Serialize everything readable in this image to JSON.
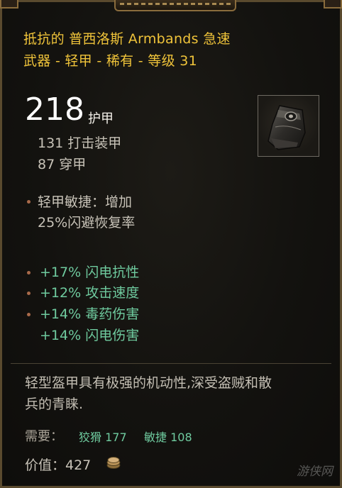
{
  "item": {
    "name_line1": "抵抗的 普西洛斯 Armbands 急速",
    "name_line2": "武器 - 轻甲 - 稀有 - 等级 31",
    "icon": "armband-icon"
  },
  "armor": {
    "value": "218",
    "label": "护甲",
    "sub_stats": [
      "131 打击装甲",
      "87 穿甲"
    ]
  },
  "passive": {
    "line1": "轻甲敏捷：增加",
    "line2": "25%闪避恢复率"
  },
  "affixes": [
    "+17% 闪电抗性",
    "+12% 攻击速度",
    "+14% 毒药伤害",
    "+14% 闪电伤害"
  ],
  "flavor": {
    "line1": "轻型盔甲具有极强的机动性,深受盗贼和散",
    "line2": "兵的青睐."
  },
  "requirements": {
    "label": "需要：",
    "req1": "狡猾 177",
    "req2": "敏捷 108"
  },
  "price": {
    "label": "价值：427",
    "icon": "gold-coin-icon"
  },
  "watermark": "游侠网",
  "colors": {
    "title": "#f0c43a",
    "affix": "#6fcb9f",
    "border": "#5a4a2e",
    "bullet": "#a96a4a"
  }
}
